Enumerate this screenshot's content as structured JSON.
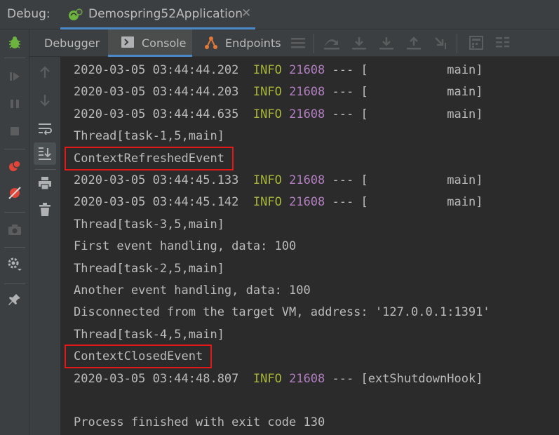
{
  "header": {
    "debug_label": "Debug:",
    "session_title": "Demospring52Application",
    "session_icon": "spring-boot-bug-icon",
    "close_glyph": "✕"
  },
  "toolbar": {
    "tabs": [
      {
        "label": "Debugger",
        "icon": null
      },
      {
        "label": "Console",
        "icon": "console-icon"
      },
      {
        "label": "Endpoints",
        "icon": "endpoints-icon"
      }
    ],
    "active_tab": "Console",
    "actions": [
      "list-threads-icon",
      "show-execution-point-icon",
      "step-over-icon",
      "step-into-icon",
      "step-out-icon",
      "run-to-cursor-icon",
      "evaluate-expression-icon",
      "trace-icon"
    ]
  },
  "left_rail": {
    "icons": [
      "debug-bug-icon",
      "resume-icon",
      "pause-icon",
      "stop-icon",
      "view-breakpoints-icon",
      "mute-breakpoints-icon",
      "camera-icon",
      "settings-icon",
      "pin-icon"
    ]
  },
  "console_strip": {
    "icons": [
      "up-arrow-icon",
      "down-arrow-icon",
      "soft-wrap-icon",
      "scroll-to-end-icon",
      "print-icon",
      "trash-icon"
    ]
  },
  "console": {
    "lines": [
      {
        "kind": "log",
        "ts": "2020-03-05 03:44:44.202",
        "level": "INFO",
        "pid": "21608",
        "rest": " --- [           main]"
      },
      {
        "kind": "log",
        "ts": "2020-03-05 03:44:44.203",
        "level": "INFO",
        "pid": "21608",
        "rest": " --- [           main]"
      },
      {
        "kind": "log",
        "ts": "2020-03-05 03:44:44.635",
        "level": "INFO",
        "pid": "21608",
        "rest": " --- [           main]"
      },
      {
        "kind": "text",
        "text": "Thread[task-1,5,main]"
      },
      {
        "kind": "text",
        "text": "ContextRefreshedEvent",
        "highlight": true
      },
      {
        "kind": "log",
        "ts": "2020-03-05 03:44:45.133",
        "level": "INFO",
        "pid": "21608",
        "rest": " --- [           main]"
      },
      {
        "kind": "log",
        "ts": "2020-03-05 03:44:45.142",
        "level": "INFO",
        "pid": "21608",
        "rest": " --- [           main]"
      },
      {
        "kind": "text",
        "text": "Thread[task-3,5,main]"
      },
      {
        "kind": "text",
        "text": "First event handling, data: 100"
      },
      {
        "kind": "text",
        "text": "Thread[task-2,5,main]"
      },
      {
        "kind": "text",
        "text": "Another event handling, data: 100"
      },
      {
        "kind": "text",
        "text": "Disconnected from the target VM, address: '127.0.0.1:1391'"
      },
      {
        "kind": "text",
        "text": "Thread[task-4,5,main]"
      },
      {
        "kind": "text",
        "text": "ContextClosedEvent",
        "highlight": true
      },
      {
        "kind": "log",
        "ts": "2020-03-05 03:44:48.807",
        "level": "INFO",
        "pid": "21608",
        "rest": " --- [extShutdownHook]"
      },
      {
        "kind": "text",
        "text": ""
      },
      {
        "kind": "text",
        "text": "Process finished with exit code 130"
      }
    ]
  },
  "colors": {
    "background": "#2b2b2b",
    "panel": "#3c3f41",
    "info": "#a9b53a",
    "pid": "#b27ec0",
    "highlight_border": "#e01818",
    "accent": "#4a88c7"
  }
}
